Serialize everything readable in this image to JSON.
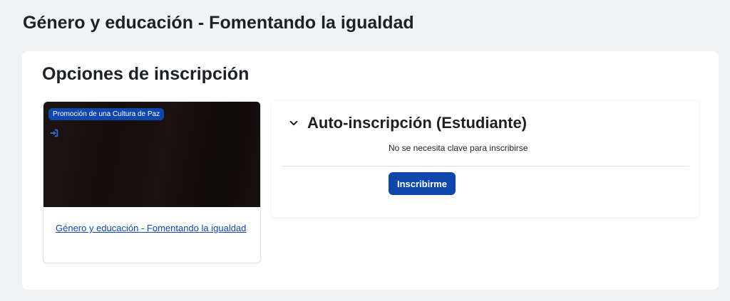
{
  "page": {
    "title": "Género y educación - Fomentando la igualdad"
  },
  "enrolment": {
    "heading": "Opciones de inscripción",
    "course_card": {
      "category": "Promoción de una Cultura de Paz",
      "enrol_icon": "sign-in-icon",
      "link_text": "Género y educación - Fomentando la igualdad"
    },
    "method": {
      "title": "Auto-inscripción (Estudiante)",
      "toggle_icon": "chevron-down-icon",
      "message": "No se necesita clave para inscribirse",
      "button_label": "Inscribirme"
    }
  },
  "colors": {
    "page_background": "#f1f2f5",
    "card_background": "#ffffff",
    "brand_primary": "#0f47ad",
    "text_primary": "#1d2125",
    "course_image_dark": "#140e0c"
  }
}
